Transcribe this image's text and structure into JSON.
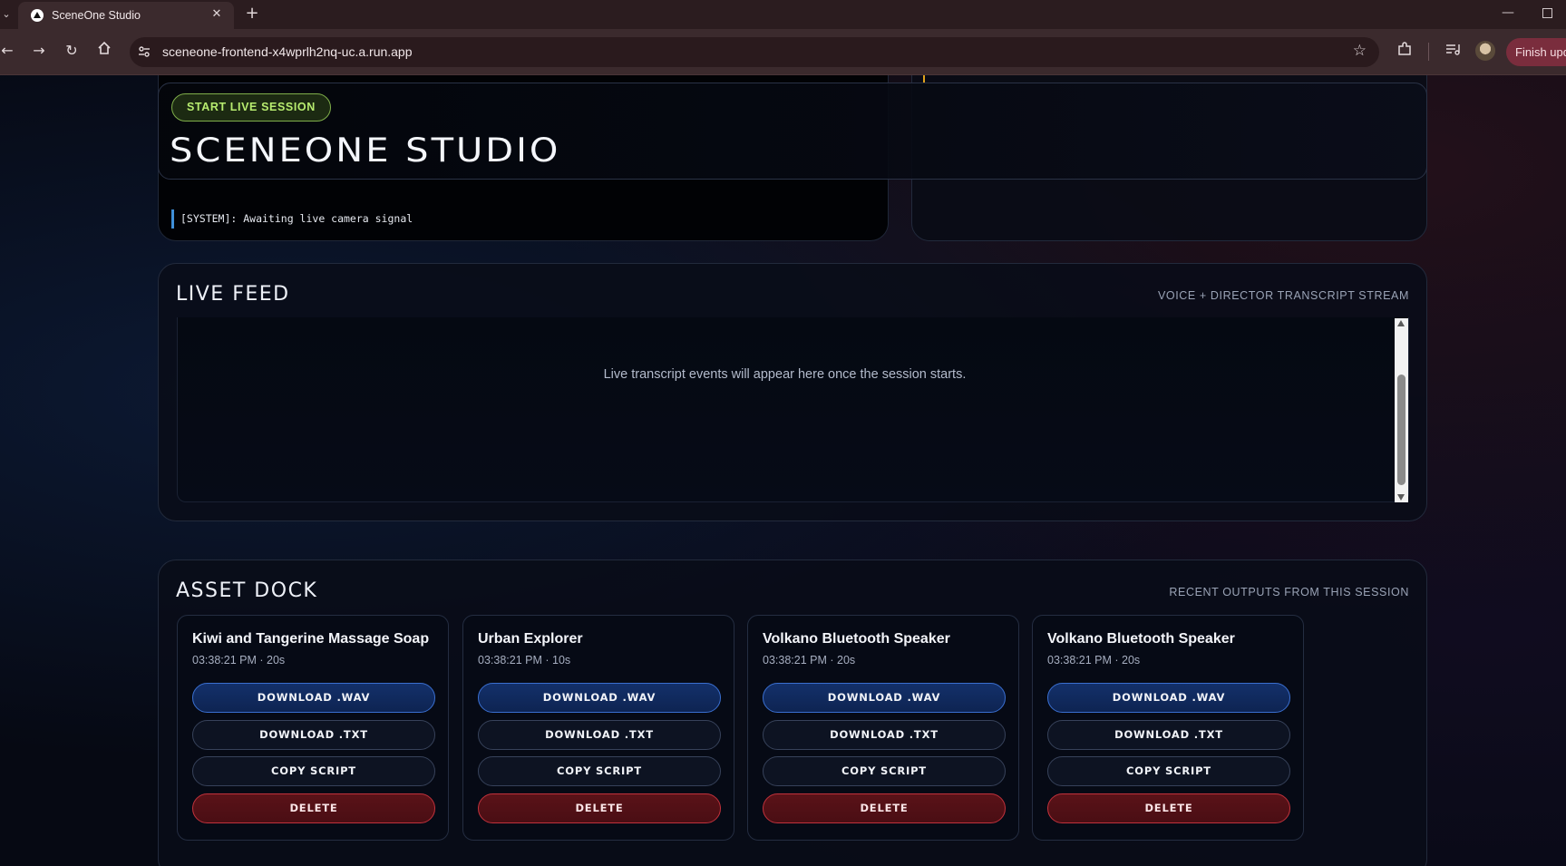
{
  "browser": {
    "tab_title": "SceneOne Studio",
    "url": "sceneone-frontend-x4wprlh2nq-uc.a.run.app",
    "finish_button": "Finish upd"
  },
  "hero": {
    "live_button": "START LIVE SESSION",
    "title": "SCENEONE STUDIO",
    "system_log": "[SYSTEM]: Awaiting live camera signal"
  },
  "live_feed": {
    "title": "LIVE FEED",
    "subtitle": "VOICE + DIRECTOR TRANSCRIPT STREAM",
    "empty_message": "Live transcript events will appear here once the session starts."
  },
  "asset_dock": {
    "title": "ASSET DOCK",
    "subtitle": "RECENT OUTPUTS FROM THIS SESSION",
    "buttons": {
      "download_wav": "DOWNLOAD .WAV",
      "download_txt": "DOWNLOAD .TXT",
      "copy_script": "COPY SCRIPT",
      "delete": "DELETE"
    },
    "assets": [
      {
        "name": "Kiwi and Tangerine Massage Soap",
        "meta": "03:38:21 PM · 20s"
      },
      {
        "name": "Urban Explorer",
        "meta": "03:38:21 PM · 10s"
      },
      {
        "name": "Volkano Bluetooth Speaker",
        "meta": "03:38:21 PM · 20s"
      },
      {
        "name": "Volkano Bluetooth Speaker",
        "meta": "03:38:21 PM · 20s"
      }
    ]
  },
  "colors": {
    "accent_green": "#b7ec6f",
    "download_blue": "#3a6fd0",
    "delete_red": "#c2323c"
  },
  "icons": [
    "chevron-down-icon",
    "favicon-icon",
    "close-icon",
    "plus-icon",
    "back-icon",
    "forward-icon",
    "reload-icon",
    "home-icon",
    "site-info-icon",
    "star-icon",
    "extensions-icon",
    "media-icon",
    "avatar"
  ]
}
